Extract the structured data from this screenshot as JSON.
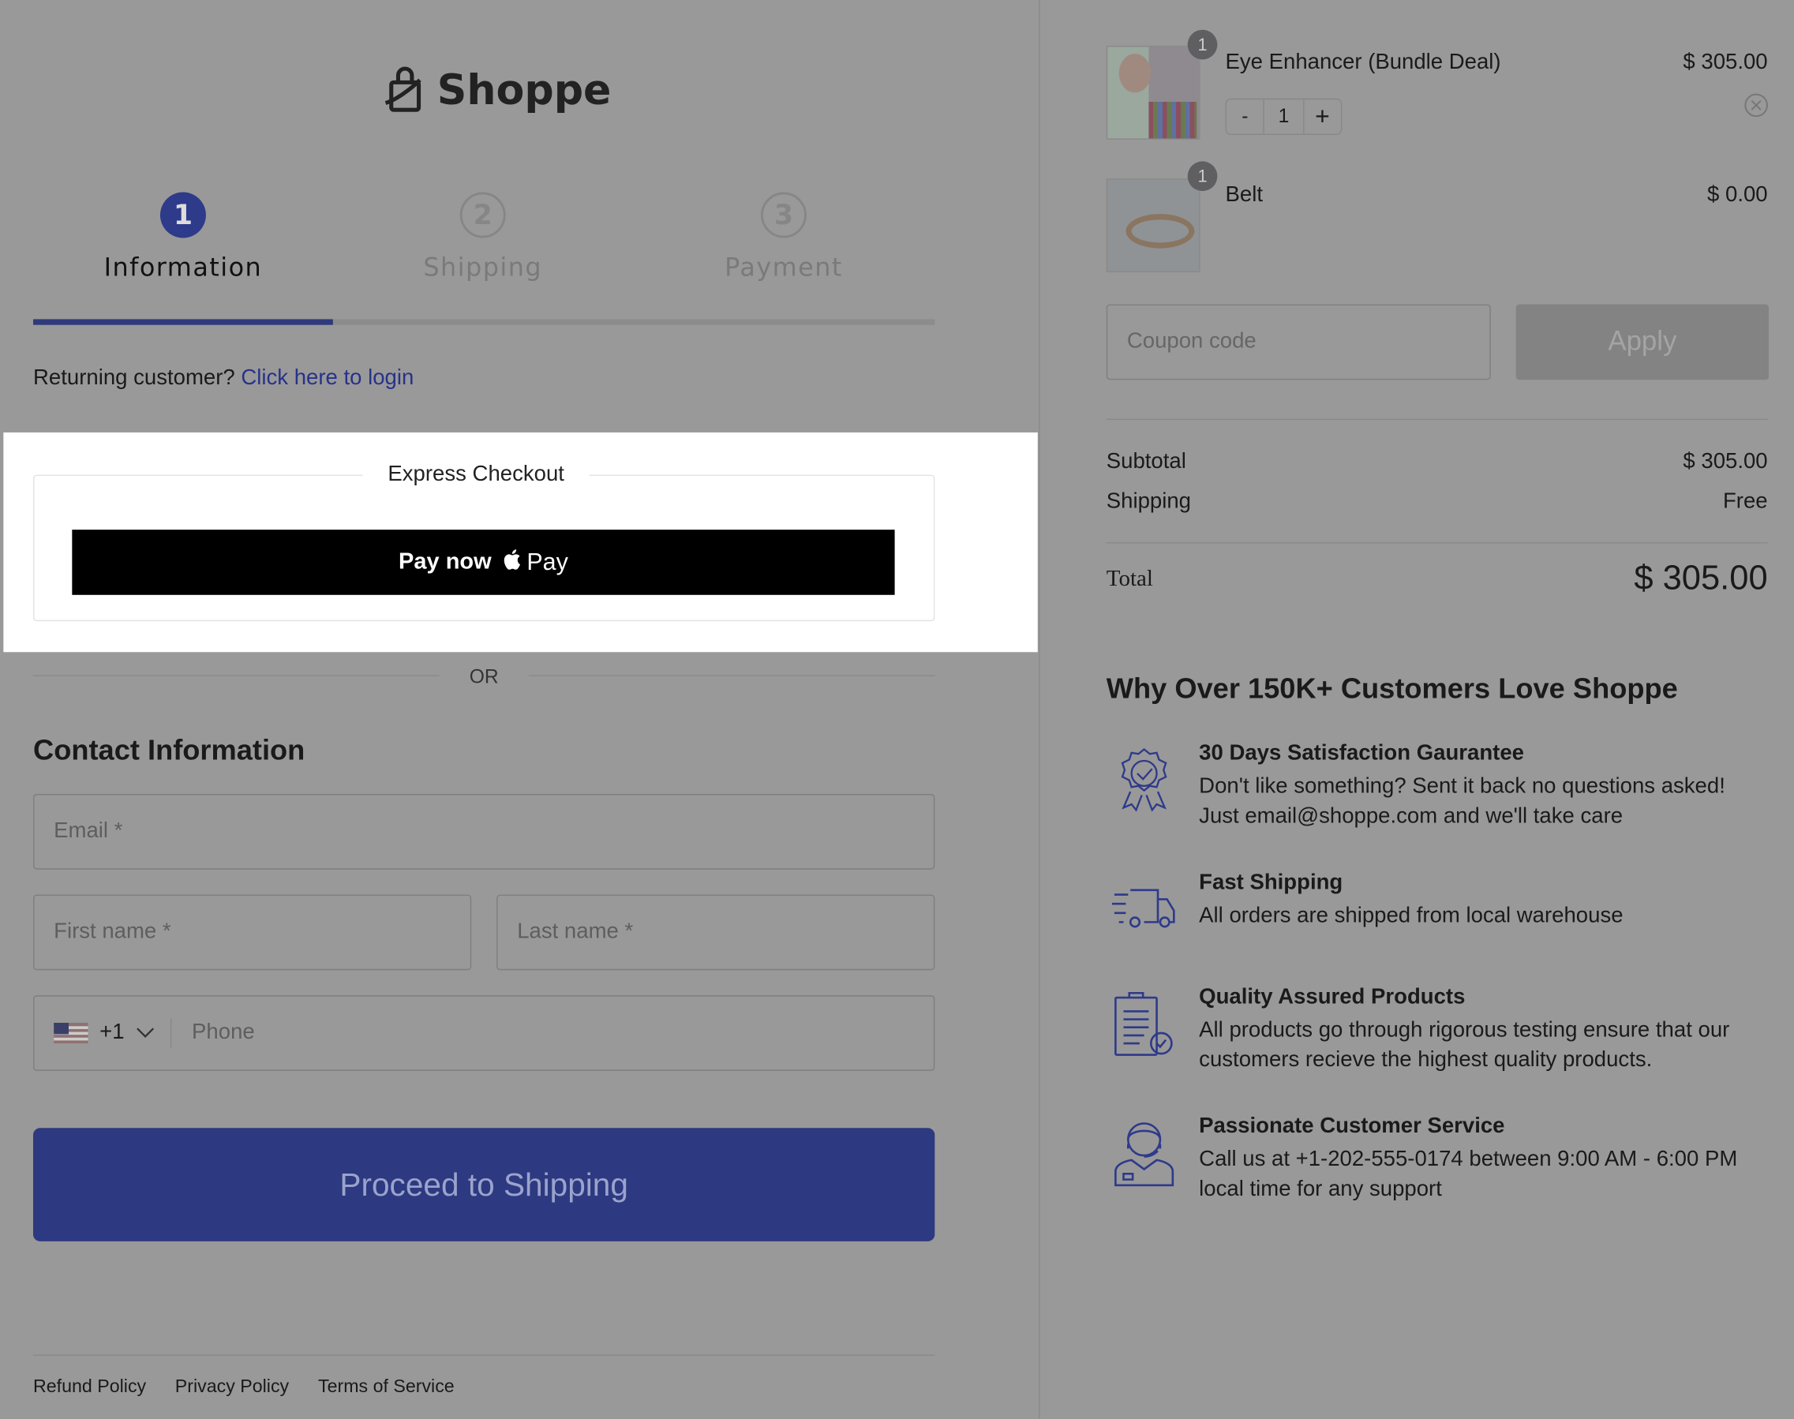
{
  "brand": {
    "name": "Shoppe",
    "icon": "shopping-bag-icon"
  },
  "steps": [
    {
      "number": "1",
      "label": "Information",
      "active": true
    },
    {
      "number": "2",
      "label": "Shipping",
      "active": false
    },
    {
      "number": "3",
      "label": "Payment",
      "active": false
    }
  ],
  "progress_fraction": 0.333,
  "returning": {
    "text": "Returning customer?",
    "link": "Click here to login"
  },
  "express": {
    "title": "Express Checkout",
    "pay_label": "Pay now",
    "pay_brand": "Pay",
    "pay_icon": "apple-icon"
  },
  "or_label": "OR",
  "contact": {
    "title": "Contact Information",
    "email_placeholder": "Email *",
    "first_placeholder": "First name *",
    "last_placeholder": "Last name *",
    "country_code": "+1",
    "country_flag": "us-flag-icon",
    "phone_placeholder": "Phone"
  },
  "proceed_label": "Proceed to Shipping",
  "footer": [
    "Refund Policy",
    "Privacy Policy",
    "Terms of Service"
  ],
  "cart": {
    "items": [
      {
        "name": "Eye Enhancer (Bundle Deal)",
        "price": "$ 305.00",
        "qty": "1",
        "badge": "1"
      },
      {
        "name": "Belt",
        "price": "$ 0.00",
        "badge": "1"
      }
    ],
    "qty_minus": "-",
    "qty_plus": "+",
    "coupon_placeholder": "Coupon code",
    "apply_label": "Apply",
    "subtotal_label": "Subtotal",
    "subtotal": "$ 305.00",
    "shipping_label": "Shipping",
    "shipping": "Free",
    "total_label": "Total",
    "total": "$ 305.00"
  },
  "why": {
    "title": "Why Over 150K+ Customers Love Shoppe",
    "features": [
      {
        "icon": "award-badge-icon",
        "title": "30 Days Satisfaction Gaurantee",
        "body": "Don't like something? Sent it back no questions asked! Just email@shoppe.com and we'll take care"
      },
      {
        "icon": "truck-icon",
        "title": "Fast Shipping",
        "body": "All orders are shipped from local warehouse"
      },
      {
        "icon": "clipboard-check-icon",
        "title": "Quality Assured Products",
        "body": "All products go through rigorous testing ensure that our customers recieve the highest quality products."
      },
      {
        "icon": "support-agent-icon",
        "title": "Passionate Customer Service",
        "body": "Call us at +1-202-555-0174 between 9:00 AM - 6:00 PM local time for any support"
      }
    ]
  },
  "colors": {
    "primary": "#2e3a8a",
    "overlay": "#999999",
    "icon_blue": "#2e3a8a"
  }
}
